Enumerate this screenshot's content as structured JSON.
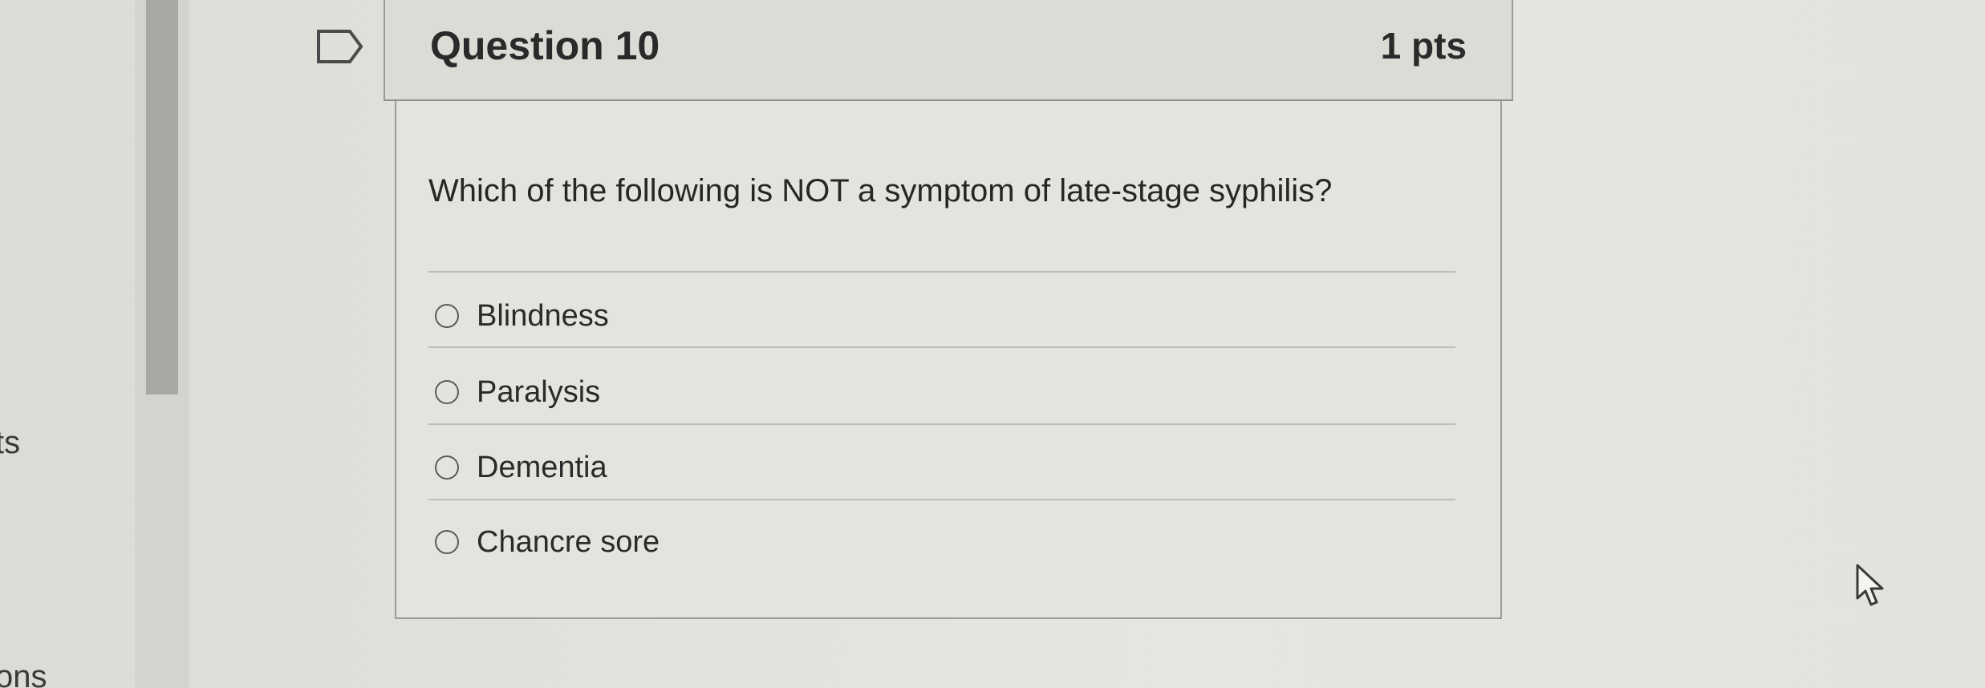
{
  "edge": {
    "text_1": "ts",
    "text_2": "ons"
  },
  "question": {
    "title": "Question 10",
    "points": "1 pts",
    "text": "Which of the following is NOT a symptom of late-stage syphilis?",
    "answers": [
      {
        "label": "Blindness",
        "selected": false
      },
      {
        "label": "Paralysis",
        "selected": false
      },
      {
        "label": "Dementia",
        "selected": false
      },
      {
        "label": "Chancre sore",
        "selected": false
      }
    ]
  },
  "icons": {
    "flag": "flag-icon",
    "cursor": "mouse-pointer-icon"
  },
  "colors": {
    "background": "#e3e3de",
    "header_bg": "#dcdcd7",
    "border": "#9a9a96",
    "text": "#2a2a2a"
  }
}
